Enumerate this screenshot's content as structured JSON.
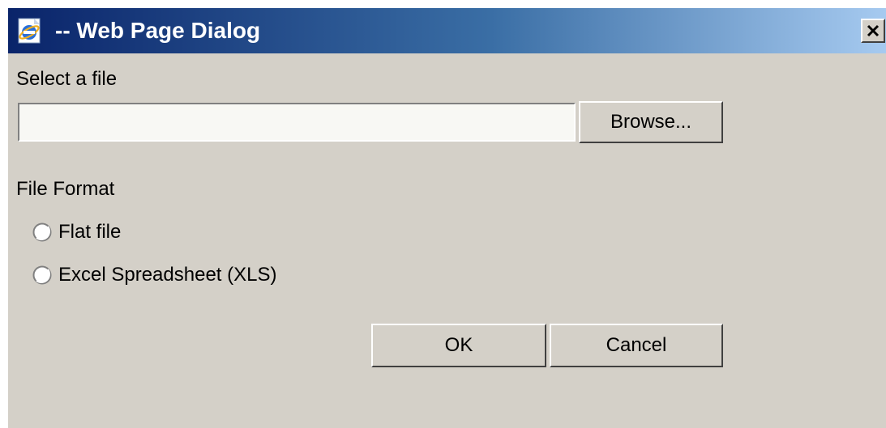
{
  "window": {
    "title": "-- Web Page Dialog",
    "icon": "ie-icon",
    "close_label": "close"
  },
  "file": {
    "label": "Select a file",
    "value": "",
    "browse_label": "Browse..."
  },
  "format": {
    "label": "File Format",
    "options": [
      {
        "label": "Flat file",
        "selected": false
      },
      {
        "label": "Excel Spreadsheet (XLS)",
        "selected": false
      }
    ]
  },
  "actions": {
    "ok_label": "OK",
    "cancel_label": "Cancel"
  },
  "colors": {
    "face": "#d4d0c8",
    "title_start": "#0a246a",
    "title_end": "#a6caf0"
  }
}
